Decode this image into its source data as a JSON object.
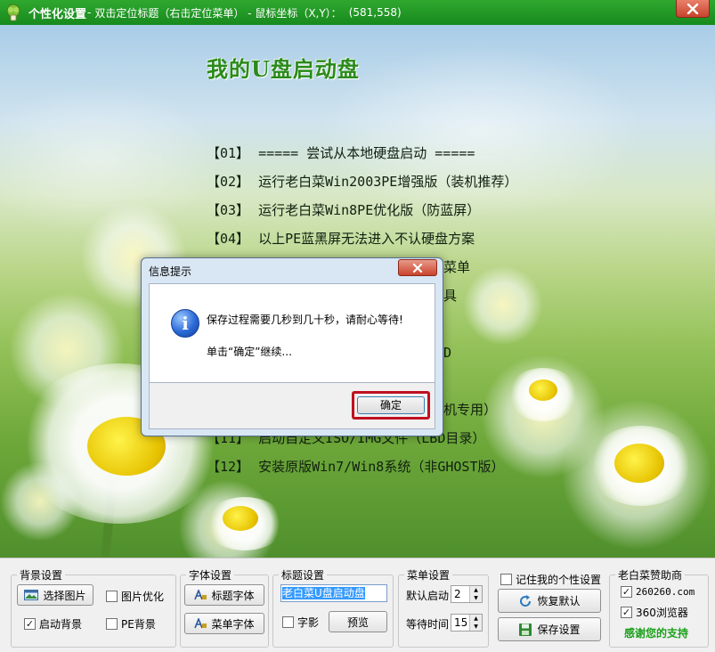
{
  "titlebar": {
    "app_name": "个性化设置",
    "separator": "-",
    "hint": "双击定位标题（右击定位菜单） - 鼠标坐标（X,Y）：",
    "coords": "(581,558)"
  },
  "menu": {
    "title": "我的U盘启动盘",
    "items": [
      {
        "num": "【01】",
        "label": "===== 尝试从本地硬盘启动 ====="
      },
      {
        "num": "【02】",
        "label": "运行老白菜Win2003PE增强版（装机推荐）"
      },
      {
        "num": "【03】",
        "label": "运行老白菜Win8PE优化版（防蓝屏）"
      },
      {
        "num": "【04】",
        "label": "以上PE蓝黑屏无法进入不认硬盘方案"
      },
      {
        "num": "",
        "label": "菜单"
      },
      {
        "num": "",
        "label": "具"
      },
      {
        "num": "",
        "label": ""
      },
      {
        "num": "",
        "label": "D"
      },
      {
        "num": "",
        "label": ""
      },
      {
        "num": "",
        "label": "机专用）"
      },
      {
        "num": "【11】",
        "label": "启动自定义ISO/IMG文件（LBD目录）"
      },
      {
        "num": "【12】",
        "label": "安装原版Win7/Win8系统（非GHOST版）"
      }
    ]
  },
  "dialog": {
    "title": "信息提示",
    "icon": "info-icon",
    "message_line1": "保存过程需要几秒到几十秒，请耐心等待!",
    "message_line2": "单击“确定”继续...",
    "ok_label": "确定",
    "ok_highlight_color": "#c01020"
  },
  "panel": {
    "background": {
      "group_label": "背景设置",
      "select_image": "选择图片",
      "image_optimize": "图片优化",
      "image_optimize_checked": false,
      "boot_background": "启动背景",
      "boot_background_checked": true,
      "pe_background": "PE背景",
      "pe_background_checked": false
    },
    "font": {
      "group_label": "字体设置",
      "title_font": "标题字体",
      "menu_font": "菜单字体"
    },
    "title": {
      "group_label": "标题设置",
      "title_text": "老白菜U盘启动盘",
      "shadow": "字影",
      "shadow_checked": false,
      "preview": "预览"
    },
    "menu_settings": {
      "group_label": "菜单设置",
      "default_boot_label": "默认启动",
      "default_boot_value": "2",
      "wait_time_label": "等待时间",
      "wait_time_value": "15"
    },
    "actions": {
      "remember": "记住我的个性设置",
      "remember_checked": false,
      "restore_default": "恢复默认",
      "save_settings": "保存设置"
    },
    "sponsor": {
      "group_label": "老白菜赞助商",
      "site1": "260260.com",
      "site1_checked": true,
      "site2": "360浏览器",
      "site2_checked": true,
      "thanks": "感谢您的支持"
    }
  },
  "colors": {
    "titlebar_green": "#178a1d",
    "menu_title_green": "#2a8a1c",
    "thanks_green": "#1aa01a"
  }
}
